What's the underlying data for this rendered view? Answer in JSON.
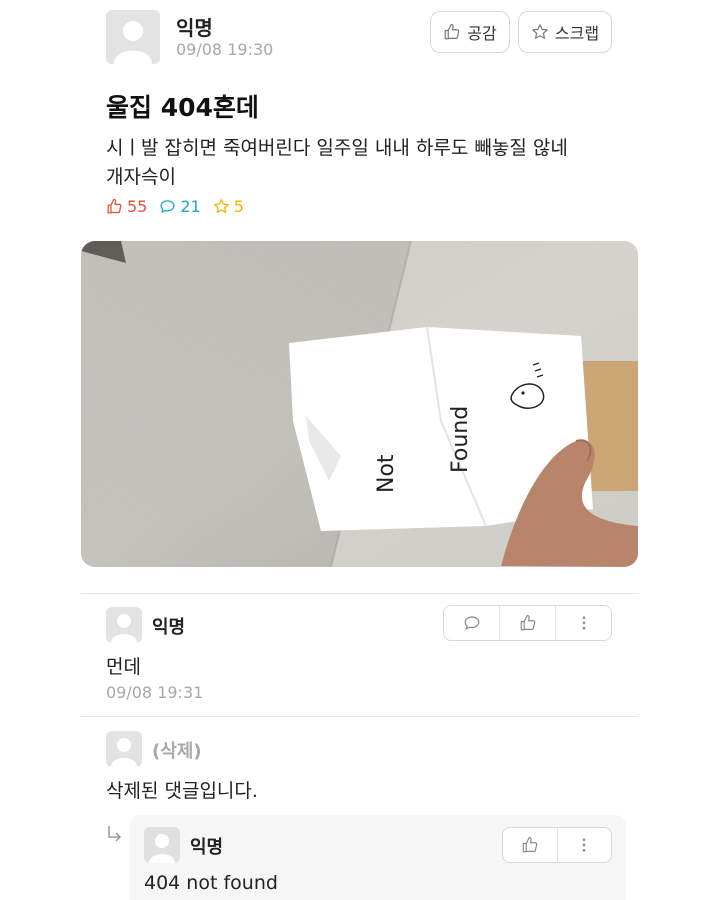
{
  "post": {
    "author": "익명",
    "timestamp": "09/08 19:30",
    "actions": {
      "like_label": "공감",
      "scrap_label": "스크랩"
    },
    "title": "울집 404혼데",
    "body_line1": "시ㅣ발 잡히면 죽여버린다 일주일 내내 하루도 빼놓질 않네",
    "body_line2": "개자슥이",
    "stats": {
      "likes": "55",
      "comments": "21",
      "scraps": "5"
    },
    "photo": {
      "note_line1": "Not",
      "note_line2": "Found"
    }
  },
  "comments": [
    {
      "author": "익명",
      "text": "먼데",
      "timestamp": "09/08 19:31"
    },
    {
      "author": "(삭제)",
      "text": "삭제된 댓글입니다."
    }
  ],
  "reply": {
    "author": "익명",
    "text": "404 not found"
  },
  "colors": {
    "like": "#e0533a",
    "comment": "#1fa5c5",
    "scrap": "#f0b400",
    "muted": "#a8a8a8"
  }
}
